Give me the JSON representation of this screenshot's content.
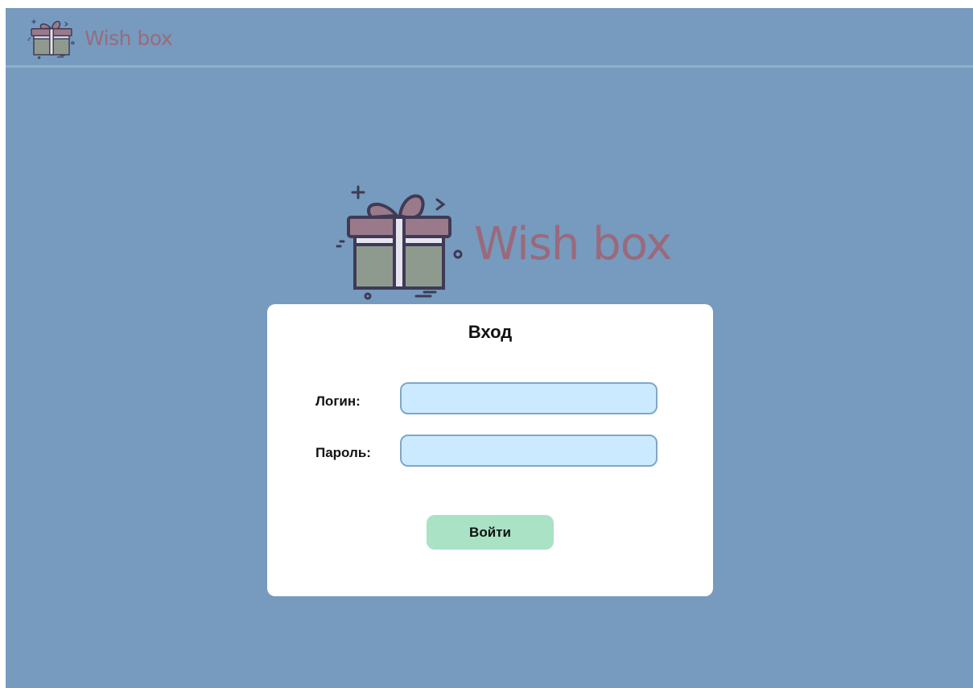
{
  "header": {
    "brand": "Wish box",
    "logo_icon": "gift-icon"
  },
  "hero": {
    "brand": "Wish box",
    "logo_icon": "gift-icon"
  },
  "login_form": {
    "title": "Вход",
    "login_label": "Логин:",
    "login_value": "",
    "password_label": "Пароль:",
    "password_value": "",
    "submit_label": "Войти"
  },
  "colors": {
    "background": "#769bbe",
    "brand_text": "#9a6a7c",
    "input_fill": "#cbeaff",
    "button_fill": "#a9e2c4",
    "gift_lid": "#9a7a8a",
    "gift_box": "#8f9a8f"
  }
}
